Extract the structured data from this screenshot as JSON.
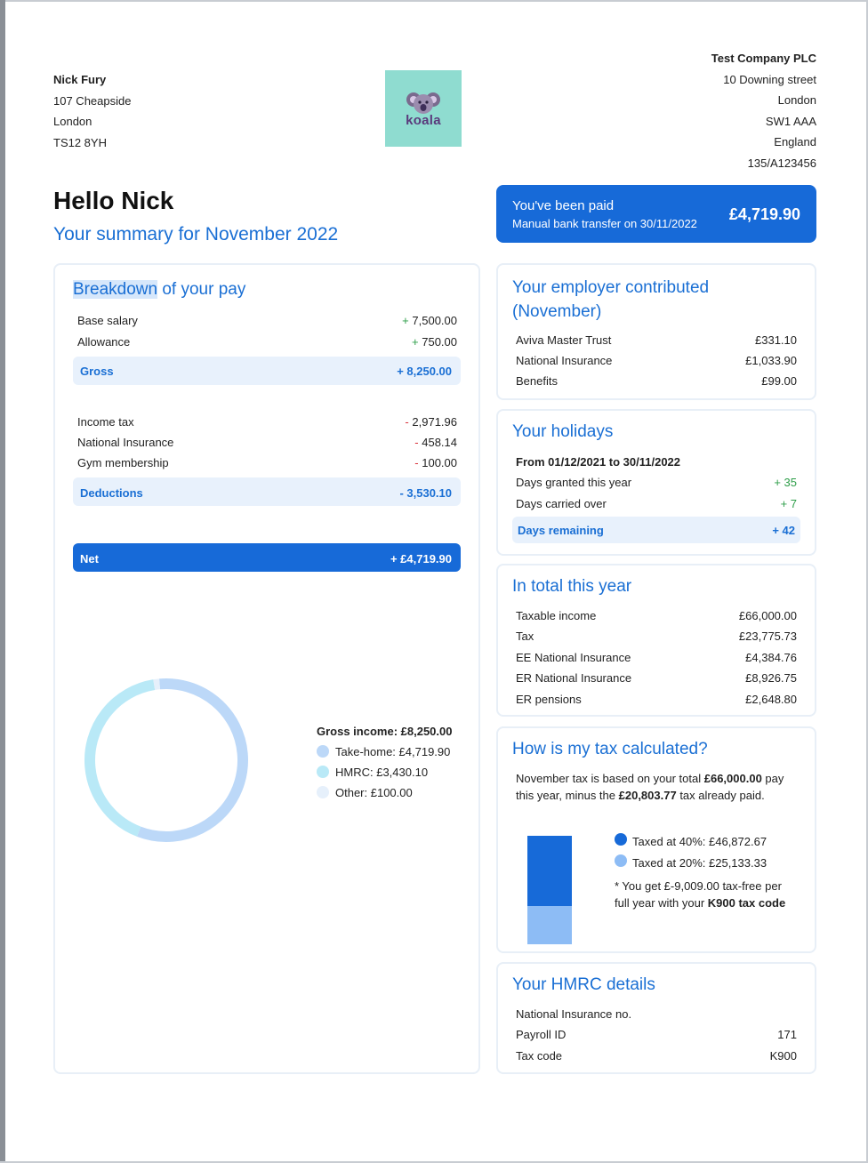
{
  "employee": {
    "name": "Nick Fury",
    "address_lines": [
      "107 Cheapside",
      "London",
      "TS12 8YH"
    ]
  },
  "company": {
    "name": "Test Company PLC",
    "address_lines": [
      "10 Downing street",
      "London",
      "SW1 AAA",
      "England",
      "135/A123456"
    ]
  },
  "logo": {
    "text": "koala",
    "bg_color": "#8fdcd0"
  },
  "greeting": "Hello Nick",
  "summary_title": "Your summary for November 2022",
  "paid": {
    "title": "You've been paid",
    "subtitle": "Manual bank transfer on 30/11/2022",
    "amount": "£4,719.90"
  },
  "breakdown": {
    "title_highlight": "Breakdown",
    "title_rest": " of your pay",
    "earnings": [
      {
        "label": "Base salary",
        "sign": "+",
        "value": "7,500.00"
      },
      {
        "label": "Allowance",
        "sign": "+",
        "value": "750.00"
      }
    ],
    "gross": {
      "label": "Gross",
      "value": "+ 8,250.00"
    },
    "deductions": [
      {
        "label": "Income tax",
        "sign": "-",
        "value": "2,971.96"
      },
      {
        "label": "National Insurance",
        "sign": "-",
        "value": "458.14"
      },
      {
        "label": "Gym membership",
        "sign": "-",
        "value": "100.00"
      }
    ],
    "deductions_total": {
      "label": "Deductions",
      "value": "- 3,530.10"
    },
    "net": {
      "label": "Net",
      "value": "+ £4,719.90"
    }
  },
  "chart_data": {
    "type": "pie",
    "title": "Gross income: £8,250.00",
    "categories": [
      "Take-home",
      "HMRC",
      "Other"
    ],
    "values": [
      4719.9,
      3430.1,
      100.0
    ],
    "legend_labels": [
      "Take-home: £4,719.90",
      "HMRC: £3,430.10",
      "Other: £100.00"
    ],
    "colors": [
      "#bcd8f8",
      "#b9e9f7",
      "#e6f0fb"
    ],
    "legend_position": "right"
  },
  "employer": {
    "title": "Your employer contributed (November)",
    "rows": [
      {
        "label": "Aviva Master Trust",
        "value": "£331.10"
      },
      {
        "label": "National Insurance",
        "value": "£1,033.90"
      },
      {
        "label": "Benefits",
        "value": "£99.00"
      }
    ]
  },
  "holidays": {
    "title": "Your holidays",
    "period": "From 01/12/2021 to 30/11/2022",
    "rows": [
      {
        "label": "Days granted this year",
        "value": "+ 35"
      },
      {
        "label": "Days carried over",
        "value": "+ 7"
      }
    ],
    "remaining": {
      "label": "Days remaining",
      "value": "+ 42"
    }
  },
  "year_total": {
    "title": "In total this year",
    "rows": [
      {
        "label": "Taxable income",
        "value": "£66,000.00"
      },
      {
        "label": "Tax",
        "value": "£23,775.73"
      },
      {
        "label": "EE National Insurance",
        "value": "£4,384.76"
      },
      {
        "label": "ER National Insurance",
        "value": "£8,926.75"
      },
      {
        "label": "ER pensions",
        "value": "£2,648.80"
      }
    ]
  },
  "tax_calc": {
    "title": "How is my tax calculated?",
    "text_1": "November tax is based on your total ",
    "amount_1": "£66,000.00",
    "text_2": " pay this year, minus the ",
    "amount_2": "£20,803.77",
    "text_3": " tax already paid.",
    "bands": [
      {
        "label": "Taxed at 40%: £46,872.67",
        "value": 46872.67,
        "color": "#176ad8"
      },
      {
        "label": "Taxed at 20%: £25,133.33",
        "value": 25133.33,
        "color": "#8dbcf5"
      }
    ],
    "note_1": "* You get £-9,009.00 tax-free per full year with your ",
    "note_code": "K900 tax code"
  },
  "hmrc": {
    "title": "Your HMRC details",
    "rows": [
      {
        "label": "National Insurance no.",
        "value": ""
      },
      {
        "label": "Payroll ID",
        "value": "171"
      },
      {
        "label": "Tax code",
        "value": "K900"
      }
    ]
  }
}
